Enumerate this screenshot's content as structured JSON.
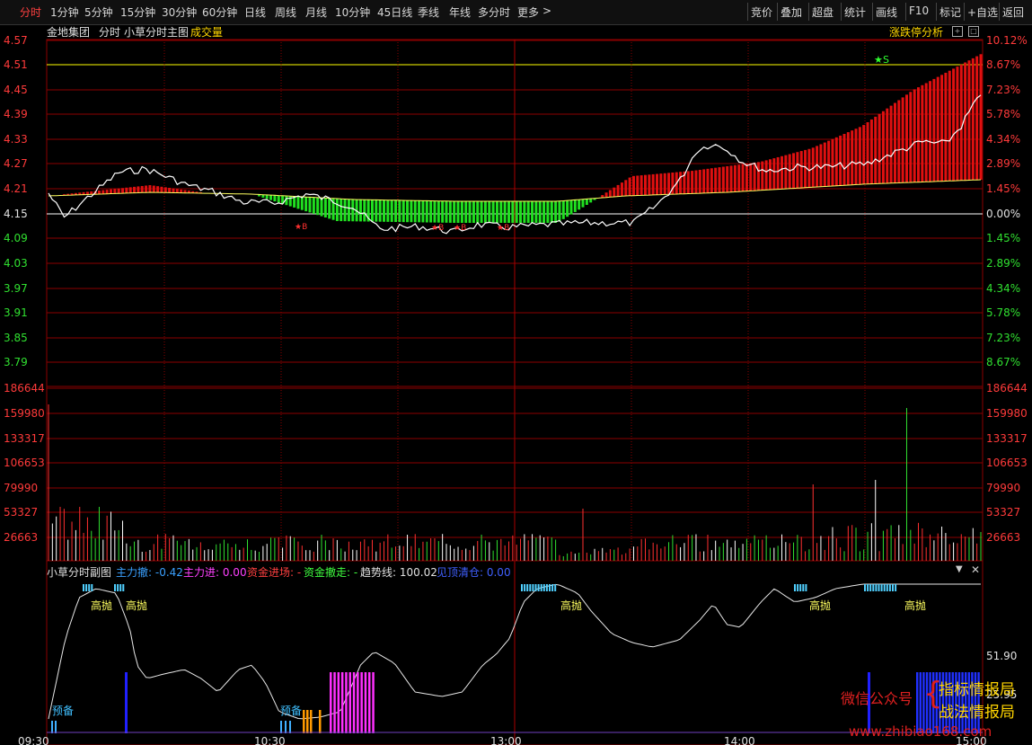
{
  "toolbar": {
    "periods": [
      "分时",
      "1分钟",
      "5分钟",
      "15分钟",
      "30分钟",
      "60分钟",
      "日线",
      "周线",
      "月线",
      "10分钟",
      "45日线",
      "季线",
      "年线",
      "多分时",
      "更多"
    ],
    "more_arrow": ">",
    "active_index": 0,
    "right_buttons": [
      "竞价",
      "叠加",
      "超盘",
      "统计",
      "画线",
      "F10",
      "标记",
      "+自选",
      "返回"
    ]
  },
  "main_panel": {
    "stock_name": "金地集团",
    "mode": "分时",
    "indicator_name": "小草分时主图",
    "volume_tab": "成交量",
    "limit_analysis": "涨跌停分析",
    "price_ticks": [
      "4.57",
      "4.51",
      "4.45",
      "4.39",
      "4.33",
      "4.27",
      "4.21",
      "4.15",
      "4.09",
      "4.03",
      "3.97",
      "3.91",
      "3.85",
      "3.79"
    ],
    "pct_ticks": [
      "10.12%",
      "8.67%",
      "7.23%",
      "5.78%",
      "4.34%",
      "2.89%",
      "1.45%",
      "0.00%",
      "1.45%",
      "2.89%",
      "4.34%",
      "5.78%",
      "7.23%",
      "8.67%"
    ],
    "signal_s": "S",
    "signal_b": "B"
  },
  "volume_panel": {
    "ticks": [
      "186644",
      "159980",
      "133317",
      "106653",
      "79990",
      "53327",
      "26663"
    ]
  },
  "sub_panel": {
    "title": "小草分时副图",
    "items": [
      {
        "label": "主力撤:",
        "value": "-0.42",
        "color": "#3aa0ff"
      },
      {
        "label": "主力进:",
        "value": "0.00",
        "color": "#ff40ff"
      },
      {
        "label": "资金进场:",
        "value": "-",
        "color": "#ff4040"
      },
      {
        "label": "资金撤走:",
        "value": "-",
        "color": "#40ff40"
      },
      {
        "label": "趋势线:",
        "value": "100.02",
        "color": "#e0e0e0"
      },
      {
        "label": "见顶清仓:",
        "value": "0.00",
        "color": "#4060ff"
      }
    ],
    "right_value": "51.90",
    "right_value2": "25.95",
    "high_throw": "高抛",
    "prepare": "预备"
  },
  "time_axis": [
    "09:30",
    "10:30",
    "13:00",
    "14:00",
    "15:00"
  ],
  "watermark": {
    "wechat": "微信公众号",
    "line1": "指标情报局",
    "line2": "战法情报局",
    "url": "www.zhibiao168.com"
  },
  "colors": {
    "up": "#ff3030",
    "down": "#30ff30",
    "grid": "#8b0000",
    "price_line": "#ffffff",
    "avg_line": "#ffff00"
  }
}
